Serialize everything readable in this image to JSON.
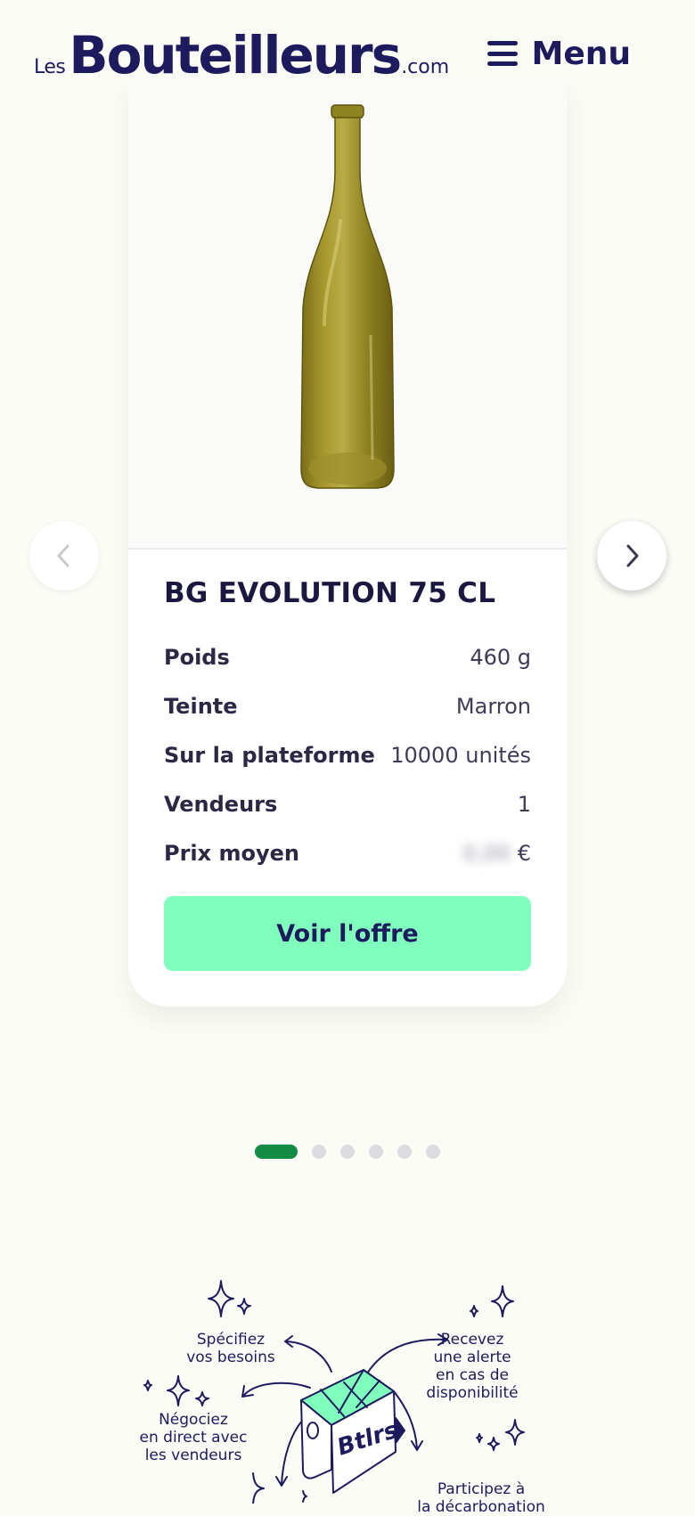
{
  "header": {
    "logo": {
      "les": "Les",
      "main": "Bouteilleurs",
      "domain": ".com"
    },
    "menu_label": "Menu",
    "menu_icon": "hamburger-icon"
  },
  "product": {
    "image_icon": "wine-bottle-image",
    "title": "BG EVOLUTION 75 CL",
    "specs": [
      {
        "label": "Poids",
        "value": "460 g"
      },
      {
        "label": "Teinte",
        "value": "Marron"
      },
      {
        "label": "Sur la plateforme",
        "value": "10000 unités"
      },
      {
        "label": "Vendeurs",
        "value": "1"
      },
      {
        "label": "Prix moyen",
        "value_hidden": "0,00",
        "currency": "€"
      }
    ],
    "cta_label": "Voir l'offre"
  },
  "carousel": {
    "prev_icon": "chevron-left-icon",
    "next_icon": "chevron-right-icon",
    "dot_count": 6,
    "active_index": 0
  },
  "illustration": {
    "box_text": "Btlrs",
    "labels": {
      "specify": "Spécifiez\nvos besoins",
      "alert": "Recevez\nune alerte\nen cas de\ndisponibilité",
      "negotiate": "Négociez\nen direct avec\nles vendeurs",
      "participate": "Participez à\nla décarbonation"
    }
  },
  "colors": {
    "brand_navy": "#1d1a5e",
    "cta_green": "#80ffbc",
    "dot_active": "#138b45",
    "page_bg": "#fcfcf7"
  }
}
